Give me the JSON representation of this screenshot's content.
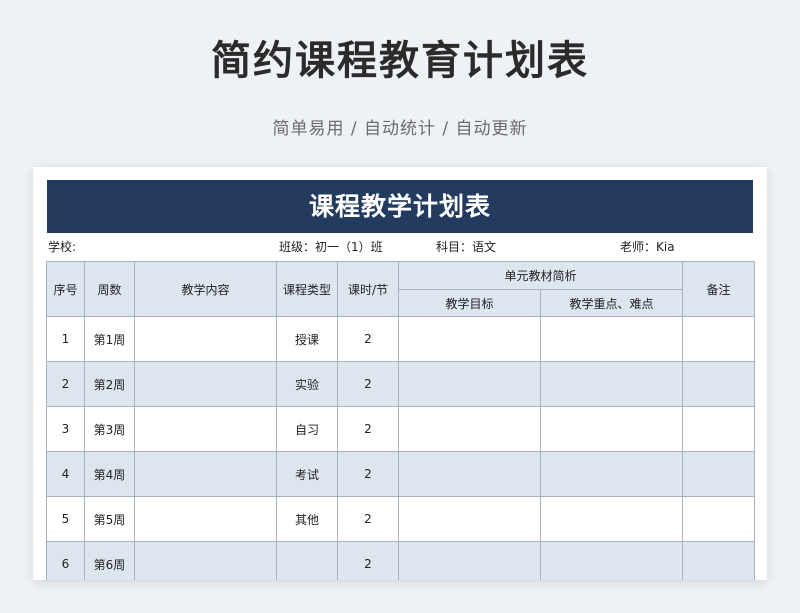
{
  "page": {
    "title": "简约课程教育计划表",
    "subtitle": "简单易用 / 自动统计 / 自动更新"
  },
  "sheet": {
    "banner": "课程教学计划表",
    "info": {
      "school": "学校:",
      "class": "班级：初一（1）班",
      "subject": "科目：语文",
      "teacher": "老师：Kia"
    },
    "headers": {
      "index": "序号",
      "week": "周数",
      "content": "教学内容",
      "type": "课程类型",
      "hours": "课时/节",
      "analysis": "单元教材简析",
      "goal": "教学目标",
      "keypoints": "教学重点、难点",
      "remark": "备注"
    },
    "rows": [
      {
        "index": "1",
        "week": "第1周",
        "content": "",
        "type": "授课",
        "hours": "2",
        "goal": "",
        "keypoints": "",
        "remark": ""
      },
      {
        "index": "2",
        "week": "第2周",
        "content": "",
        "type": "实验",
        "hours": "2",
        "goal": "",
        "keypoints": "",
        "remark": ""
      },
      {
        "index": "3",
        "week": "第3周",
        "content": "",
        "type": "自习",
        "hours": "2",
        "goal": "",
        "keypoints": "",
        "remark": ""
      },
      {
        "index": "4",
        "week": "第4周",
        "content": "",
        "type": "考试",
        "hours": "2",
        "goal": "",
        "keypoints": "",
        "remark": ""
      },
      {
        "index": "5",
        "week": "第5周",
        "content": "",
        "type": "其他",
        "hours": "2",
        "goal": "",
        "keypoints": "",
        "remark": ""
      },
      {
        "index": "6",
        "week": "第6周",
        "content": "",
        "type": "",
        "hours": "2",
        "goal": "",
        "keypoints": "",
        "remark": ""
      }
    ]
  },
  "colors": {
    "banner": "#223b5f",
    "header_fill": "#dde5ee",
    "alt_row_fill": "#dde5ee",
    "border": "#a9b3bf",
    "background": "#eef1f5"
  }
}
